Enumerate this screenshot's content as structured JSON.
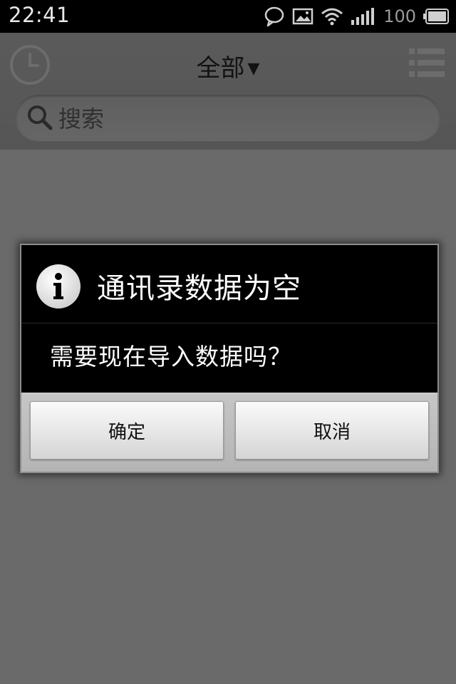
{
  "status_bar": {
    "time": "22:41",
    "battery_level": "100",
    "icons": [
      "chat-bubble-icon",
      "image-icon",
      "wifi-icon",
      "signal-icon",
      "battery-icon"
    ]
  },
  "header": {
    "filter_title": "全部",
    "filter_arrow": "▼",
    "search_placeholder": "搜索",
    "icons": [
      "history-clock-icon",
      "list-menu-icon",
      "search-icon"
    ]
  },
  "dialog": {
    "icon": "info-icon",
    "title": "通讯录数据为空",
    "message": "需要现在导入数据吗？",
    "ok_label": "确定",
    "cancel_label": "取消"
  },
  "colors": {
    "overlay_background": "#6a6a6a",
    "dialog_background": "#000000",
    "button_bar": "#c0c0c0"
  }
}
